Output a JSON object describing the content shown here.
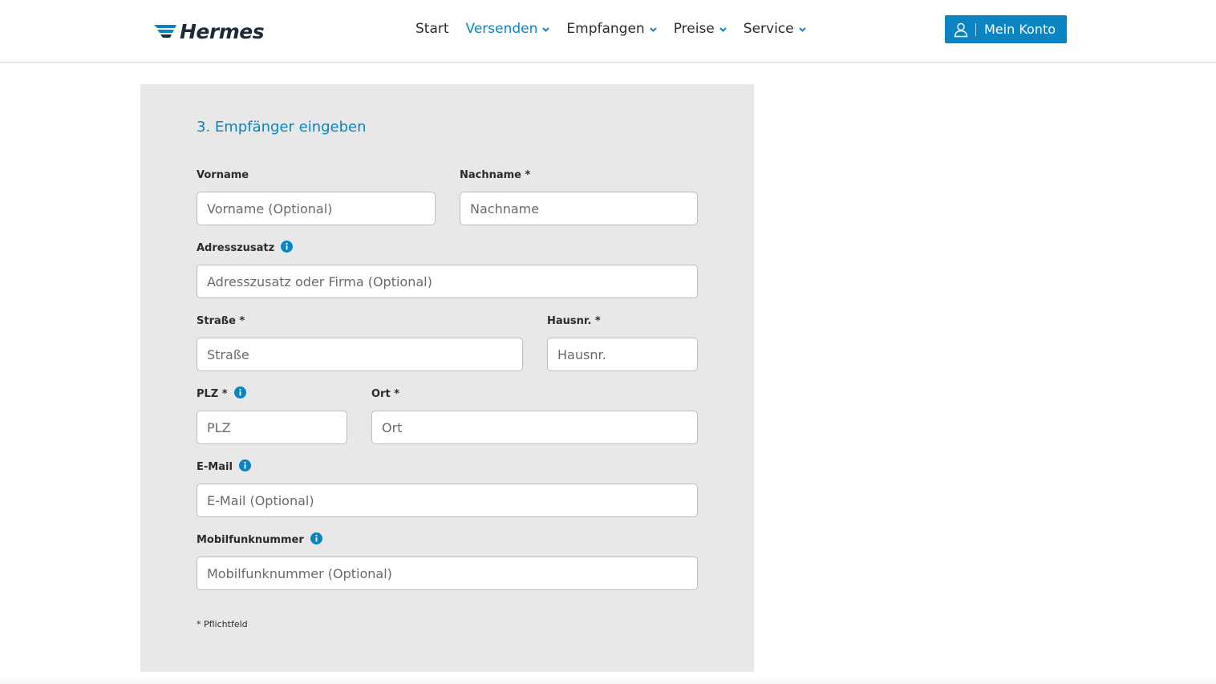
{
  "header": {
    "logo_text": "Hermes",
    "nav": [
      {
        "label": "Start",
        "active": false,
        "dropdown": false
      },
      {
        "label": "Versenden",
        "active": true,
        "dropdown": true
      },
      {
        "label": "Empfangen",
        "active": false,
        "dropdown": true
      },
      {
        "label": "Preise",
        "active": false,
        "dropdown": true
      },
      {
        "label": "Service",
        "active": false,
        "dropdown": true
      }
    ],
    "account_label": "Mein Konto",
    "accent_color": "#0a84c2"
  },
  "form": {
    "title": "3. Empfänger eingeben",
    "vorname": {
      "label": "Vorname",
      "placeholder": "Vorname (Optional)",
      "value": ""
    },
    "nachname": {
      "label": "Nachname *",
      "placeholder": "Nachname",
      "value": ""
    },
    "adresszusatz": {
      "label": "Adresszusatz",
      "placeholder": "Adresszusatz oder Firma (Optional)",
      "value": ""
    },
    "strasse": {
      "label": "Straße *",
      "placeholder": "Straße",
      "value": ""
    },
    "hausnr": {
      "label": "Hausnr. *",
      "placeholder": "Hausnr.",
      "value": ""
    },
    "plz": {
      "label": "PLZ *",
      "placeholder": "PLZ",
      "value": ""
    },
    "ort": {
      "label": "Ort *",
      "placeholder": "Ort",
      "value": ""
    },
    "email": {
      "label": "E-Mail",
      "placeholder": "E-Mail (Optional)",
      "value": ""
    },
    "mobil": {
      "label": "Mobilfunknummer",
      "placeholder": "Mobilfunknummer (Optional)",
      "value": ""
    },
    "footnote": "* Pflichtfeld"
  }
}
